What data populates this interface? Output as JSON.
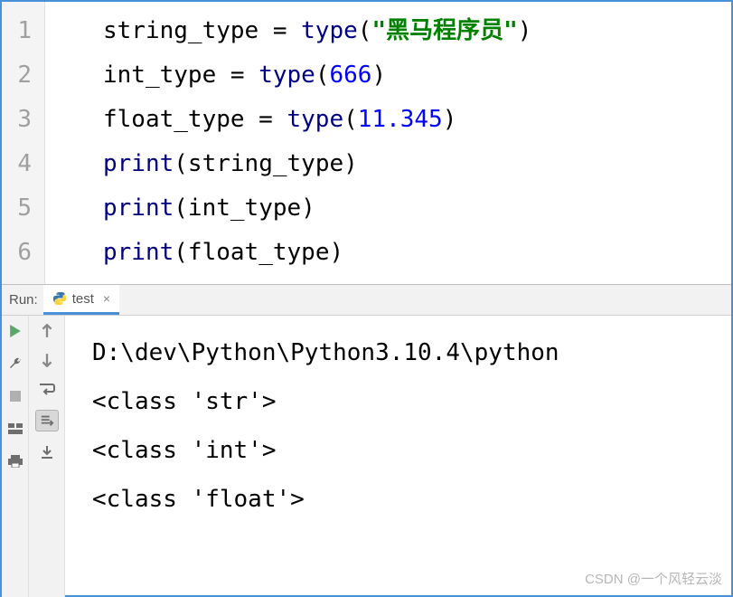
{
  "editor": {
    "gutter": [
      "1",
      "2",
      "3",
      "4",
      "5",
      "6"
    ],
    "lines": [
      {
        "t": [
          [
            "p",
            "string_type = "
          ],
          [
            "b",
            "type"
          ],
          [
            "p",
            "("
          ],
          [
            "s",
            "\"黑马程序员\""
          ],
          [
            "p",
            ")"
          ]
        ]
      },
      {
        "t": [
          [
            "p",
            "int_type = "
          ],
          [
            "b",
            "type"
          ],
          [
            "p",
            "("
          ],
          [
            "n",
            "666"
          ],
          [
            "p",
            ")"
          ]
        ]
      },
      {
        "t": [
          [
            "p",
            "float_type = "
          ],
          [
            "b",
            "type"
          ],
          [
            "p",
            "("
          ],
          [
            "n",
            "11.345"
          ],
          [
            "p",
            ")"
          ]
        ]
      },
      {
        "t": [
          [
            "b",
            "print"
          ],
          [
            "p",
            "(string_type)"
          ]
        ]
      },
      {
        "t": [
          [
            "b",
            "print"
          ],
          [
            "p",
            "(int_type)"
          ]
        ]
      },
      {
        "t": [
          [
            "b",
            "print"
          ],
          [
            "p",
            "(float_type)"
          ]
        ]
      }
    ]
  },
  "run": {
    "label": "Run:",
    "tab_name": "test",
    "output": [
      "D:\\dev\\Python\\Python3.10.4\\python",
      "<class 'str'>",
      "<class 'int'>",
      "<class 'float'>"
    ]
  },
  "watermark": "CSDN @一个风轻云淡"
}
